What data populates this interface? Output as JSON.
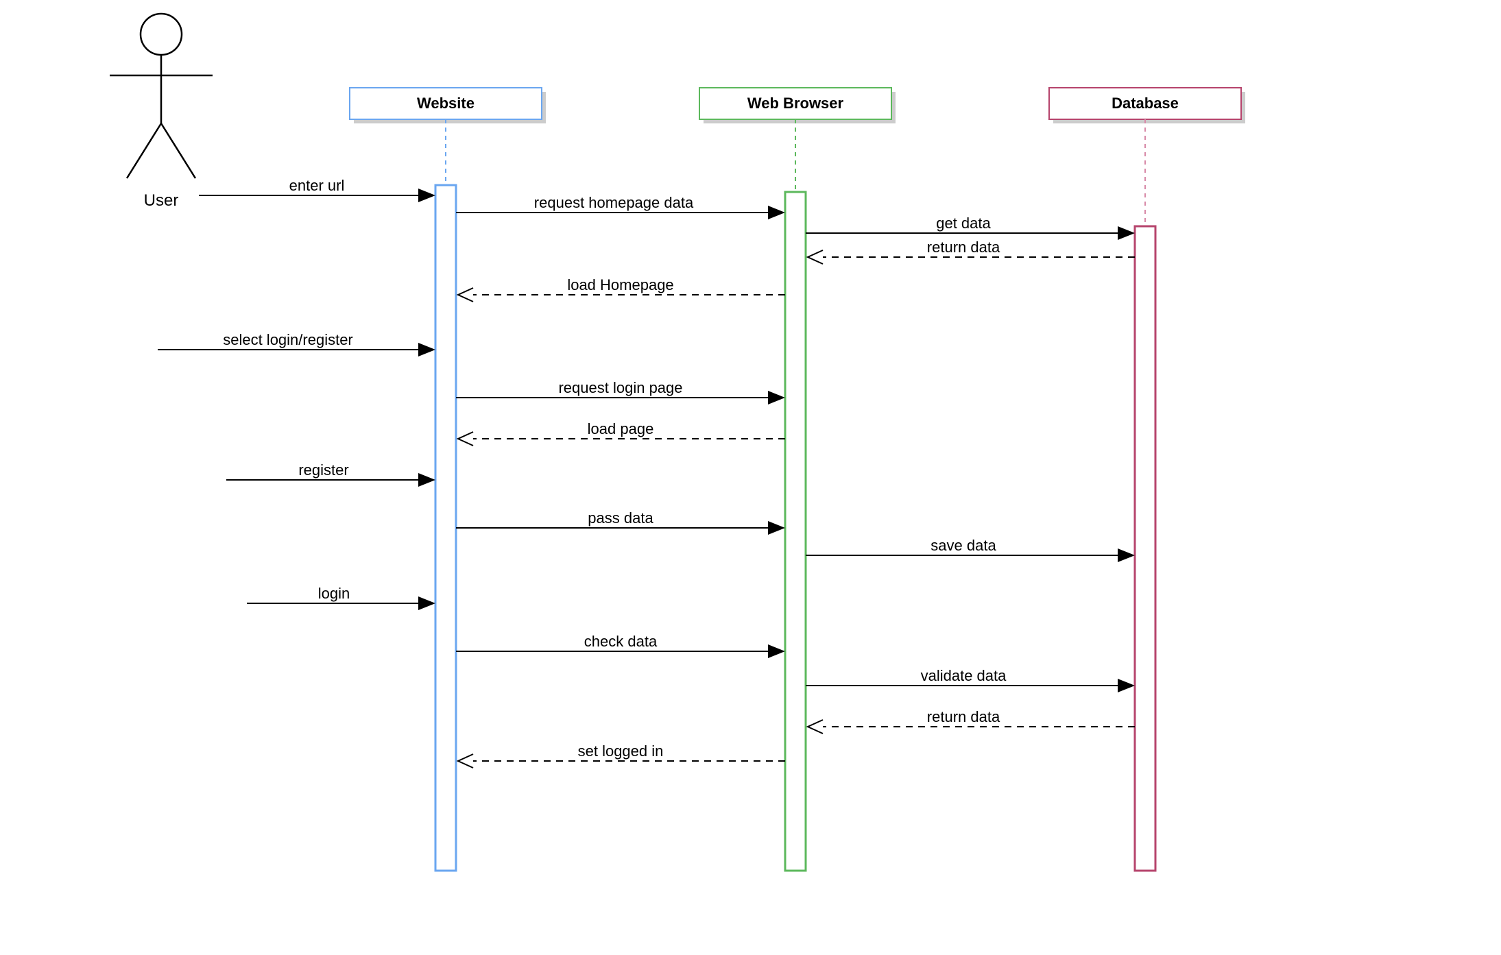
{
  "actor": {
    "label": "User"
  },
  "lifelines": {
    "website": {
      "label": "Website",
      "color": "#6aa6f0",
      "dash_color": "#6aa6f0"
    },
    "browser": {
      "label": "Web Browser",
      "color": "#5cb85c",
      "dash_color": "#5cb85c"
    },
    "database": {
      "label": "Database",
      "color": "#b6446c",
      "dash_color": "#b6446c"
    }
  },
  "messages": {
    "m1": {
      "label": "enter url"
    },
    "m2": {
      "label": "request homepage data"
    },
    "m3": {
      "label": "get data"
    },
    "m4": {
      "label": "return data"
    },
    "m5": {
      "label": "load Homepage"
    },
    "m6": {
      "label": "select login/register"
    },
    "m7": {
      "label": "request login page"
    },
    "m8": {
      "label": "load page"
    },
    "m9": {
      "label": "register"
    },
    "m10": {
      "label": "pass data"
    },
    "m11": {
      "label": "save data"
    },
    "m12": {
      "label": "login"
    },
    "m13": {
      "label": "check data"
    },
    "m14": {
      "label": "validate data"
    },
    "m15": {
      "label": "return data"
    },
    "m16": {
      "label": "set logged in"
    }
  }
}
